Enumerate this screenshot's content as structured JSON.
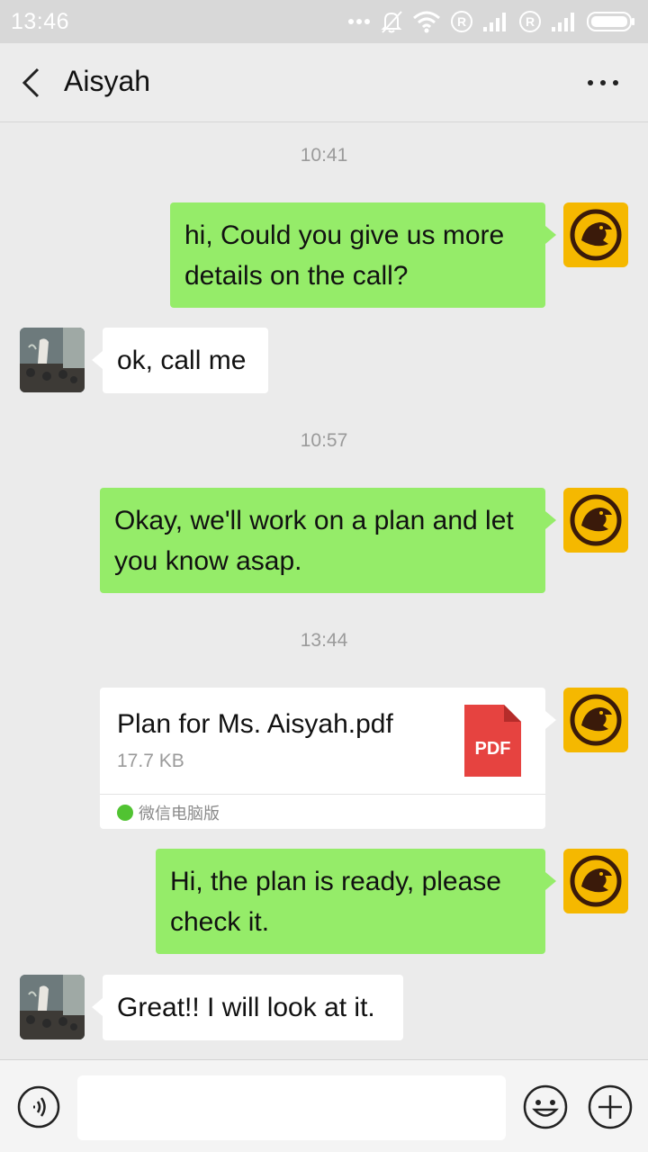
{
  "status_bar": {
    "time": "13:46",
    "icons": [
      "more-dots-icon",
      "mute-icon",
      "wifi-icon",
      "roaming-r-icon",
      "signal-icon",
      "roaming-r-icon",
      "signal-icon",
      "battery-icon"
    ]
  },
  "header": {
    "title": "Aisyah",
    "back_icon": "chevron-left-icon",
    "more_icon": "more-dots-icon"
  },
  "messages": [
    {
      "type": "timestamp",
      "text": "10:41"
    },
    {
      "type": "text",
      "side": "right",
      "text": "hi, Could you give us more details on the call?"
    },
    {
      "type": "text",
      "side": "left",
      "text": "ok, call me"
    },
    {
      "type": "timestamp",
      "text": "10:57"
    },
    {
      "type": "text",
      "side": "right",
      "text": "Okay, we'll work on a plan and let you know asap."
    },
    {
      "type": "timestamp",
      "text": "13:44"
    },
    {
      "type": "file",
      "side": "right",
      "file_name": "Plan for Ms. Aisyah.pdf",
      "file_size": "17.7 KB",
      "file_badge": "PDF",
      "source": "微信电脑版"
    },
    {
      "type": "text",
      "side": "right",
      "text": "Hi, the plan is ready, please check it."
    },
    {
      "type": "text",
      "side": "left",
      "text": "Great!! I will look at it."
    }
  ],
  "input_bar": {
    "voice_icon": "voice-icon",
    "emoji_icon": "emoji-icon",
    "plus_icon": "plus-icon",
    "input_value": ""
  },
  "colors": {
    "sent_bubble": "#95ec69",
    "received_bubble": "#ffffff",
    "background": "#ebebeb",
    "self_avatar": "#f5b800",
    "pdf_red": "#e64340"
  }
}
